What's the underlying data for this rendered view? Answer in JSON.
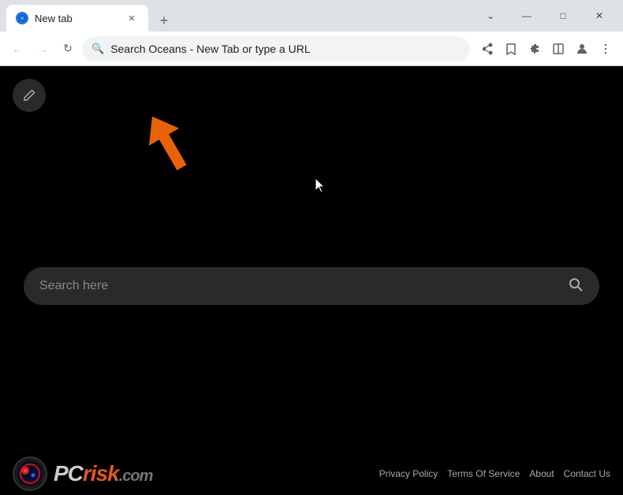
{
  "browser": {
    "tab": {
      "title": "New tab",
      "favicon_color": "#1a73e8"
    },
    "new_tab_label": "+",
    "address_bar": {
      "text": "Search Oceans - New Tab or type a URL",
      "placeholder": "Search Oceans - New Tab or type a URL"
    },
    "window_controls": {
      "minimize": "—",
      "maximize": "□",
      "close": "✕",
      "chevron_down": "⌄"
    }
  },
  "page": {
    "edit_button_icon": "✎",
    "search": {
      "placeholder": "Search here",
      "icon": "🔍"
    }
  },
  "footer": {
    "logo_text_pc": "PC",
    "logo_text_risk": "risk",
    "logo_text_dotcom": ".com",
    "links": [
      {
        "label": "Privacy Policy"
      },
      {
        "label": "Terms Of Service"
      },
      {
        "label": "About"
      },
      {
        "label": "Contact Us"
      }
    ]
  }
}
